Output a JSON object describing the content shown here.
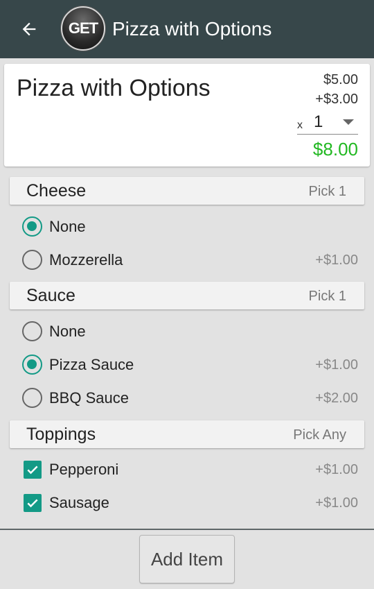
{
  "action_bar": {
    "logo_text": "GET",
    "title": "Pizza with Options"
  },
  "summary": {
    "item_name": "Pizza with Options",
    "base_price": "$5.00",
    "options_price": "+$3.00",
    "quantity_prefix": "x",
    "quantity": "1",
    "total": "$8.00"
  },
  "groups": [
    {
      "title": "Cheese",
      "rule": "Pick 1",
      "type": "radio",
      "options": [
        {
          "label": "None",
          "price": "",
          "selected": true
        },
        {
          "label": "Mozzerella",
          "price": "+$1.00",
          "selected": false
        }
      ]
    },
    {
      "title": "Sauce",
      "rule": "Pick 1",
      "type": "radio",
      "options": [
        {
          "label": "None",
          "price": "",
          "selected": false
        },
        {
          "label": "Pizza Sauce",
          "price": "+$1.00",
          "selected": true
        },
        {
          "label": "BBQ Sauce",
          "price": "+$2.00",
          "selected": false
        }
      ]
    },
    {
      "title": "Toppings",
      "rule": "Pick Any",
      "type": "checkbox",
      "options": [
        {
          "label": "Pepperoni",
          "price": "+$1.00",
          "selected": true
        },
        {
          "label": "Sausage",
          "price": "+$1.00",
          "selected": true
        }
      ]
    }
  ],
  "footer": {
    "add_button_label": "Add Item"
  },
  "colors": {
    "action_bar": "#37474a",
    "accent": "#139a86",
    "total_green": "#22b822"
  }
}
